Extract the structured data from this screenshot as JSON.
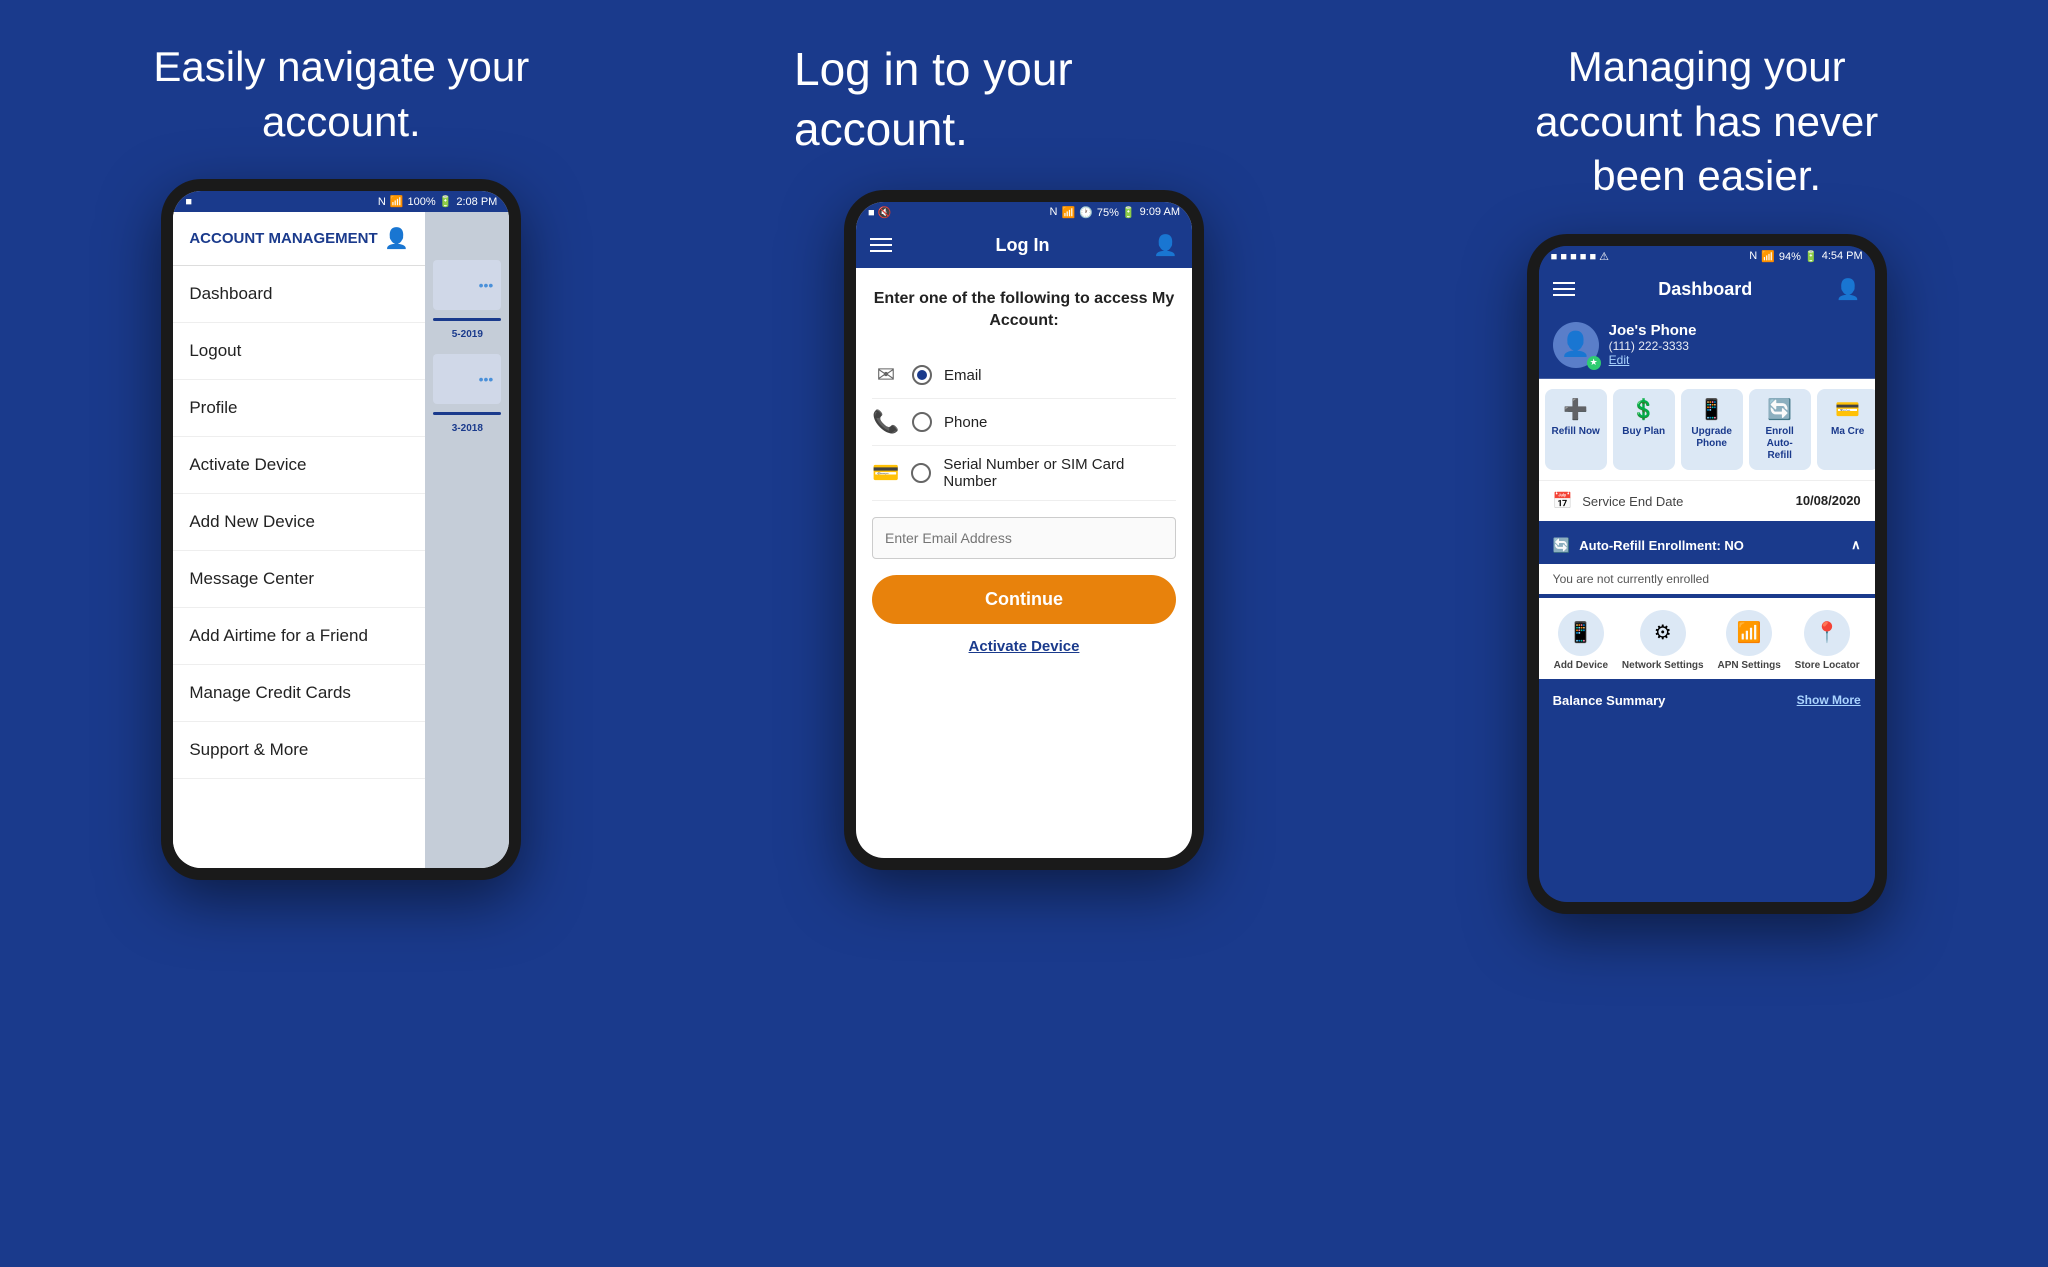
{
  "panel1": {
    "tagline": "Easily navigate your account.",
    "status": {
      "left": "■",
      "time": "2:08 PM",
      "battery": "100%",
      "signal": "NFC WiFi 4G"
    },
    "nav_header": "ACCOUNT MANAGEMENT",
    "nav_items": [
      "Dashboard",
      "Logout",
      "Profile",
      "Activate Device",
      "Add New Device",
      "Message Center",
      "Add Airtime for a Friend",
      "Manage Credit Cards",
      "Support & More"
    ],
    "content_dates": [
      "5-2019",
      "3-2018"
    ]
  },
  "panel2": {
    "tagline": "Log in to your account.",
    "status": {
      "time": "9:09 AM",
      "battery": "75%"
    },
    "app_bar_title": "Log In",
    "login_prompt": "Enter one of the following to access My Account:",
    "options": [
      {
        "icon": "✉",
        "label": "Email",
        "selected": true
      },
      {
        "icon": "📞",
        "label": "Phone",
        "selected": false
      },
      {
        "icon": "💳",
        "label": "Serial Number or SIM Card Number",
        "selected": false
      }
    ],
    "email_placeholder": "Enter Email Address",
    "continue_label": "Continue",
    "activate_label": "Activate Device"
  },
  "panel3": {
    "tagline": "Managing your account has never been easier.",
    "status": {
      "time": "4:54 PM",
      "battery": "94%"
    },
    "app_bar_title": "Dashboard",
    "user": {
      "name": "Joe's Phone",
      "phone": "(111) 222-3333",
      "edit_label": "Edit"
    },
    "quick_actions": [
      {
        "icon": "➕",
        "label": "Refill Now"
      },
      {
        "icon": "💲",
        "label": "Buy Plan"
      },
      {
        "icon": "📱",
        "label": "Upgrade Phone"
      },
      {
        "icon": "🔄",
        "label": "Enroll Auto-Refill"
      },
      {
        "icon": "💳",
        "label": "Ma Cre"
      }
    ],
    "service_end_label": "Service End Date",
    "service_end_date": "10/08/2020",
    "auto_refill_label": "Auto-Refill Enrollment: NO",
    "auto_refill_status": "You are not currently enrolled",
    "bottom_actions": [
      {
        "icon": "📱",
        "label": "Add Device"
      },
      {
        "icon": "⚙",
        "label": "Network Settings"
      },
      {
        "icon": "📶",
        "label": "APN Settings"
      },
      {
        "icon": "📍",
        "label": "Store Locator"
      }
    ],
    "balance_label": "Balance Summary",
    "show_more_label": "Show More"
  }
}
